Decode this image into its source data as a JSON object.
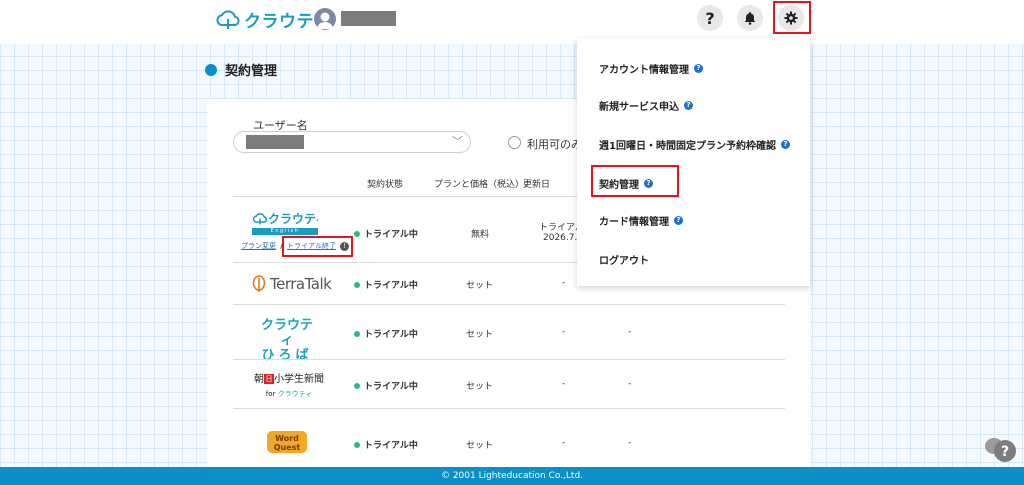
{
  "header": {
    "logo_text": "クラウティ",
    "icons": [
      "cloud-logo-icon",
      "avatar-icon",
      "help-icon",
      "bell-icon",
      "gear-icon"
    ],
    "help_glyph": "?"
  },
  "page": {
    "title": "契約管理"
  },
  "filter": {
    "username_label": "ユーザー名",
    "chevron": "﹀",
    "radio_label": "利用可のみ"
  },
  "table": {
    "headers": [
      "契約状態",
      "プランと価格（税込）",
      "更新日"
    ],
    "rows": [
      {
        "product": "クラウティ English",
        "product_sub": "English",
        "status": "トライアル中",
        "price": "無料",
        "renewal_line1": "トライアル",
        "renewal_line2": "2026.7.",
        "link_change": "プラン変更",
        "link_separator": "/",
        "link_end": "トライアル終了",
        "info_glyph": "!"
      },
      {
        "product": "TerraTalk",
        "status": "トライアル中",
        "price": "セット",
        "renewal": "-",
        "col4": ""
      },
      {
        "product_line1": "クラウティ",
        "product_line2": "ひろば",
        "status": "トライアル中",
        "price": "セット",
        "renewal": "-",
        "col4": "-"
      },
      {
        "product_line1_pre": "朝",
        "product_line1_badge": "日",
        "product_line1_post": "小学生新聞",
        "product_line2_pre": "for",
        "product_line2_brand": "クラウティ",
        "status": "トライアル中",
        "price": "セット",
        "renewal": "-",
        "col4": "-"
      },
      {
        "product": "Word Quest",
        "status": "トライアル中",
        "price": "セット",
        "renewal": "-",
        "col4": "-"
      }
    ]
  },
  "menu": {
    "items": [
      {
        "label": "アカウント情報管理",
        "help": true
      },
      {
        "label": "新規サービス申込",
        "help": true
      },
      {
        "label": "週1回曜日・時間固定プラン予約枠確認",
        "help": true
      },
      {
        "label": "契約管理",
        "help": true
      },
      {
        "label": "カード情報管理",
        "help": true
      },
      {
        "label": "ログアウト",
        "help": false
      }
    ],
    "help_glyph": "?"
  },
  "footer": {
    "text": "© 2001 Lighteducation Co.,Ltd."
  },
  "colors": {
    "brand": "#1a9bc2",
    "accent": "#0a8fc7",
    "highlight": "#e4141e",
    "status_green": "#2bbb7a"
  }
}
